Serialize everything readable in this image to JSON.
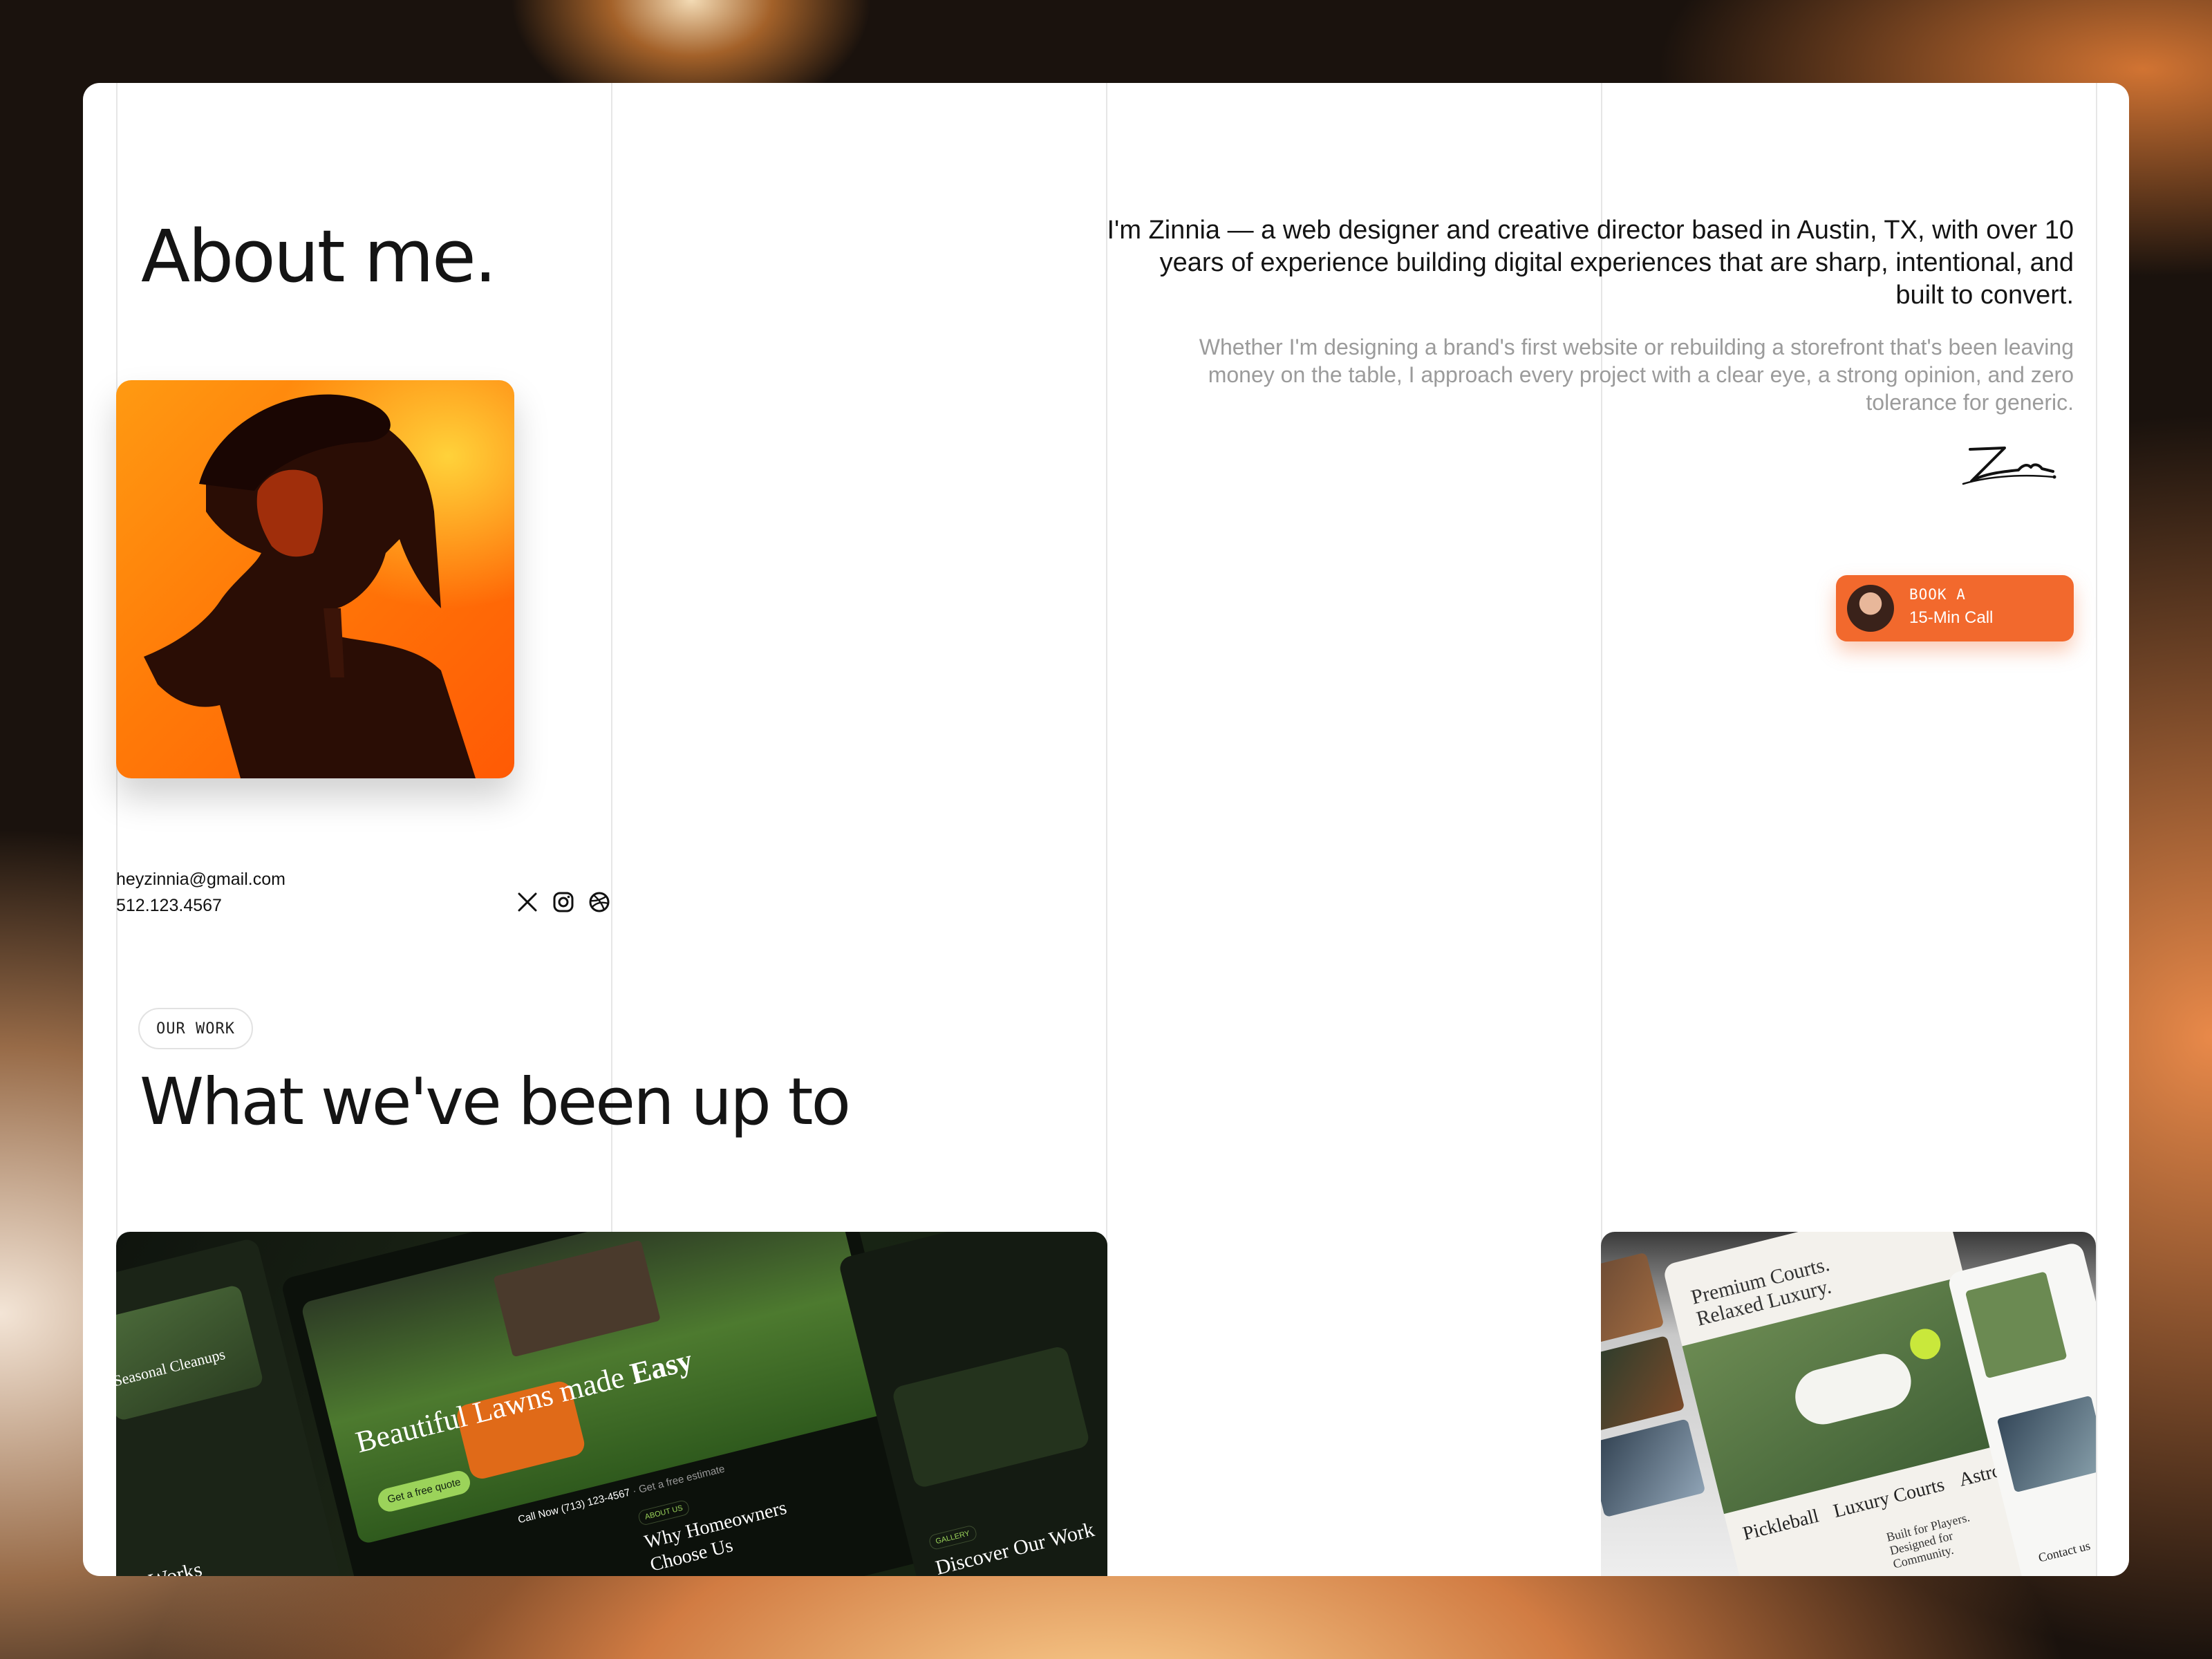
{
  "about": {
    "title": "About me.",
    "email": "heyzinnia@gmail.com",
    "phone": "512.123.4567",
    "intro": "I'm Zinnia — a web designer and creative director based in Austin, TX, with over 10 years of experience building digital experiences that are sharp, intentional, and built to convert.",
    "sub": "Whether I'm designing a brand's first website or rebuilding a storefront that's been leaving money on the table, I approach every project with a clear eye, a strong opinion, and zero tolerance for generic.",
    "signature": "Zin."
  },
  "social": [
    "x-icon",
    "instagram-icon",
    "dribbble-icon"
  ],
  "cta": {
    "line1": "BOOK A",
    "line2": "15-Min Call",
    "color": "#f2692d"
  },
  "work": {
    "eyebrow": "OUR WORK",
    "title": "What we've been up to"
  },
  "projects": {
    "lawn": {
      "hero": "Beautiful Lawns made",
      "hero_em": "Easy",
      "side_card": "Seasonal Cleanups",
      "quote_btn": "Get a free quote",
      "call": "Call Now (713) 123-4567",
      "estimate": "· Get a free estimate",
      "about_tag": "ABOUT US",
      "why": "Why Homeowners Choose Us",
      "gallery_tag": "GALLERY",
      "discover": "Discover Our Work",
      "works": "Works"
    },
    "pickleball": {
      "headline": "Premium Courts. Relaxed Luxury.",
      "strip": "Pickleball",
      "strip2": "Luxury Courts",
      "strip3": "AstroB",
      "built": "Built for Players. Designed for Community.",
      "contact": "Contact us"
    }
  }
}
